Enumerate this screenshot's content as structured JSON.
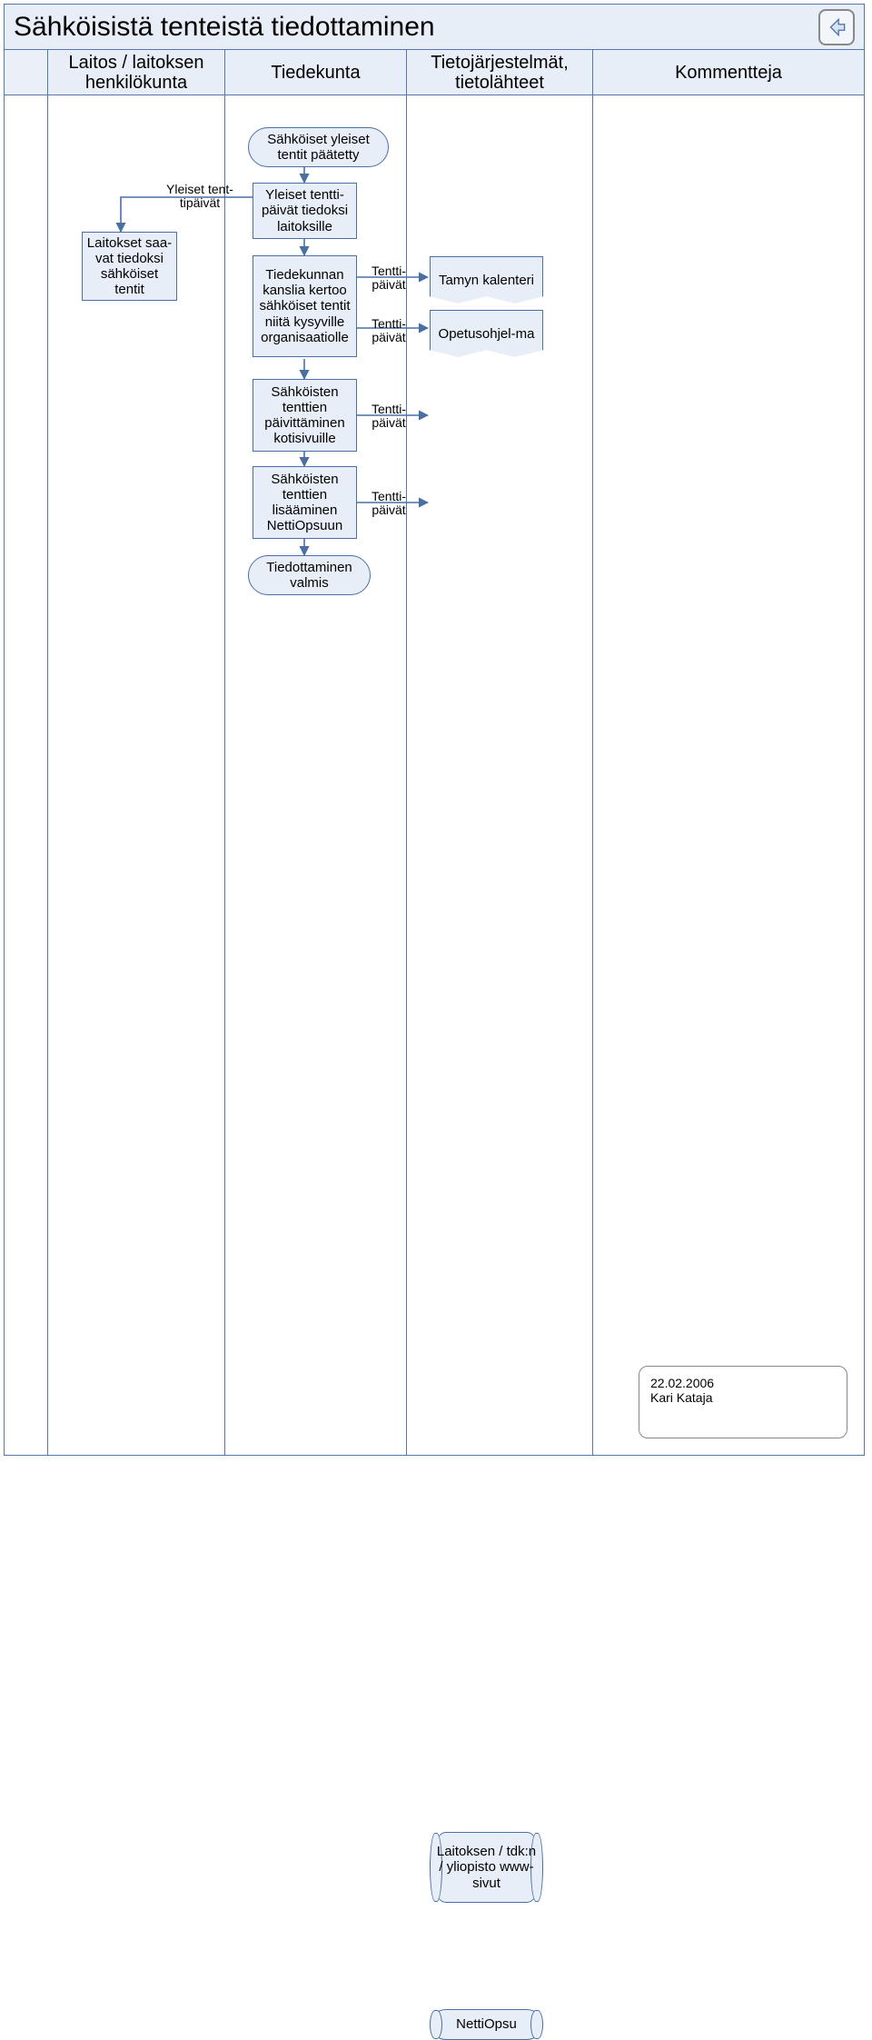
{
  "title": "Sähköisistä tenteistä tiedottaminen",
  "columns": {
    "c1_l1": "Laitos / laitoksen",
    "c1_l2": "henkilökunta",
    "c2": "Tiedekunta",
    "c3_l1": "Tietojärjestelmät,",
    "c3_l2": "tietolähteet",
    "c4": "Kommentteja"
  },
  "nodes": {
    "start": "Sähköiset yleiset tentit päätetty",
    "yleiset_tiedoksi": "Yleiset tentti-päivät tiedoksi laitoksille",
    "laitokset_saavat": "Laitokset saa-vat tiedoksi sähköiset tentit",
    "kanslia": "Tiedekunnan kanslia kertoo sähköiset tentit niitä kysyville organisaatiolle",
    "paivittaminen": "Sähköisten tenttien päivittäminen kotisivuille",
    "lisaaminen": "Sähköisten tenttien lisääminen NettiOpsuun",
    "valmis": "Tiedottaminen valmis",
    "tamyn": "Tamyn kalenteri",
    "opetusohjelma": "Opetusohjel-ma",
    "wwwsivut": "Laitoksen / tdk:n / yliopisto www-sivut",
    "nettiopsu": "NettiOpsu"
  },
  "labels": {
    "yleiset_tentti": "Yleiset tent-\ntipäivät",
    "tenttipaivat": "Tentti-\npäivät"
  },
  "meta": {
    "date": "22.02.2006",
    "author": "Kari Kataja"
  },
  "icon": {
    "back": "back-arrow"
  }
}
